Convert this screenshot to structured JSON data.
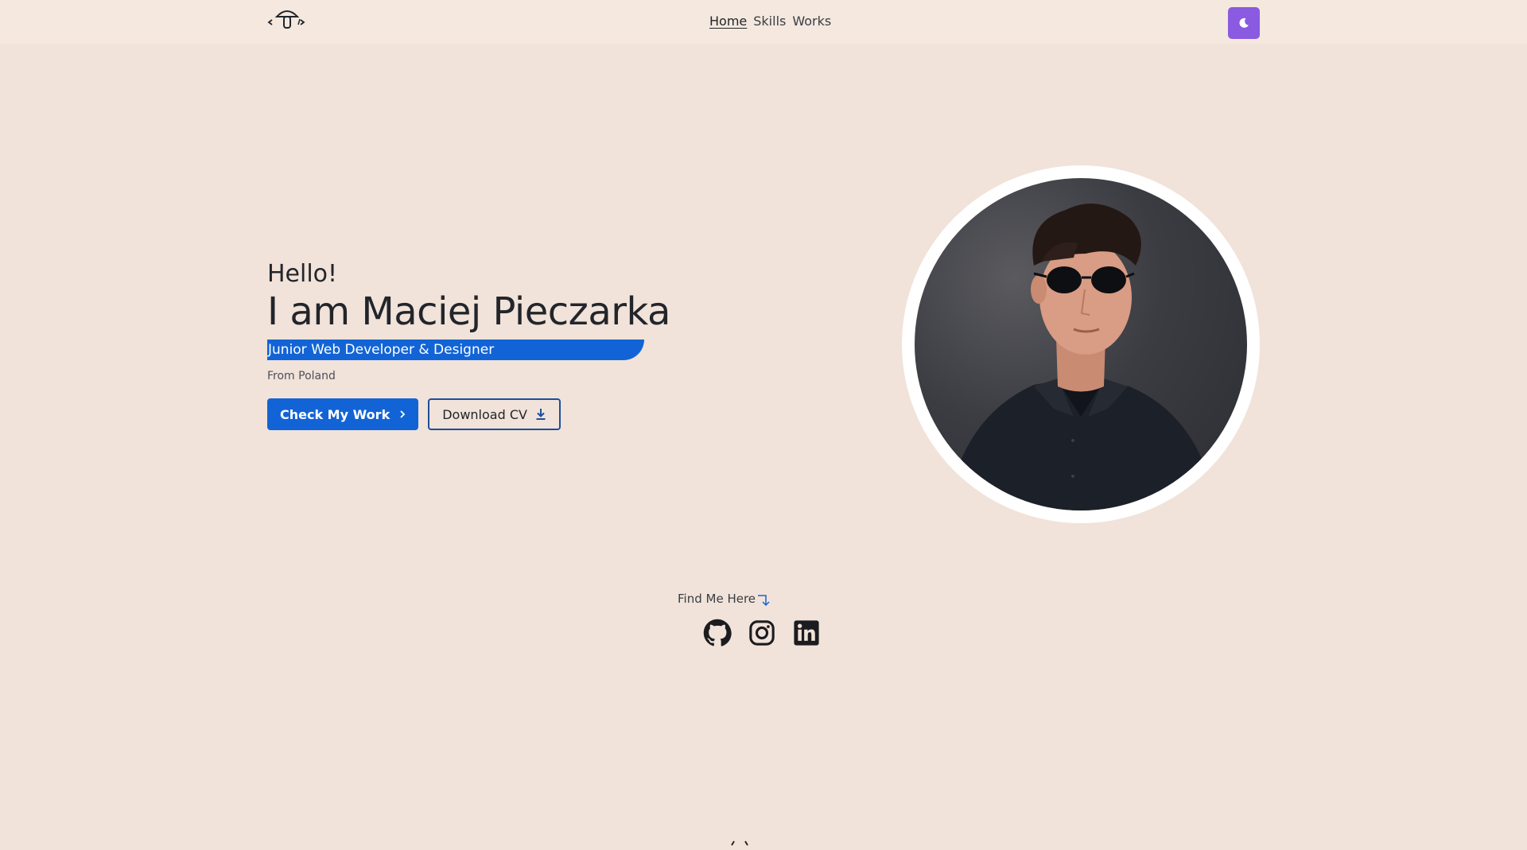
{
  "nav": {
    "links": [
      {
        "label": "Home"
      },
      {
        "label": "Skills"
      },
      {
        "label": "Works"
      }
    ],
    "theme_toggle_icon": "moon-icon"
  },
  "hero": {
    "greeting": "Hello!",
    "name": "I am Maciej Pieczarka",
    "role": "Junior Web Developer & Designer",
    "location": "From Poland",
    "primary_button": "Check My Work",
    "secondary_button": "Download CV"
  },
  "social": {
    "heading": "Find Me Here",
    "links": [
      {
        "icon": "github-icon"
      },
      {
        "icon": "instagram-icon"
      },
      {
        "icon": "linkedin-icon"
      }
    ]
  },
  "colors": {
    "background": "#f1e3d9",
    "navbar": "#f4e8df",
    "accent_blue": "#1264d6",
    "theme_button": "#8a5ae0"
  }
}
